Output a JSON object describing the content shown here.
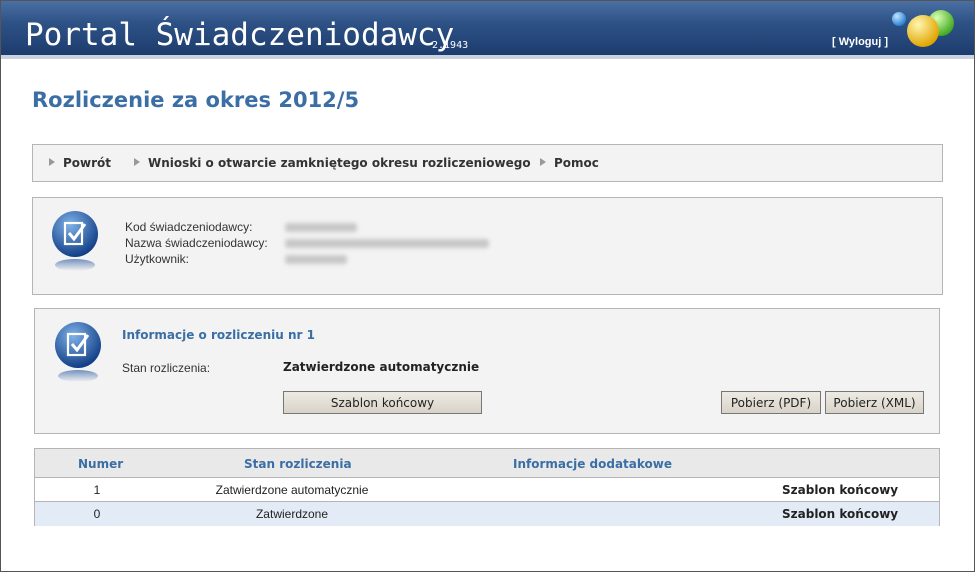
{
  "header": {
    "app_title": "Portal Świadczeniodawcy",
    "version": "2.1943",
    "logout_label": "[ Wyloguj ]",
    "colors": {
      "bar": "#2e5286",
      "ball_blue": "#3a9be0",
      "ball_yellow": "#f0c419",
      "ball_green": "#66cc33"
    }
  },
  "page": {
    "title": "Rozliczenie za okres 2012/5"
  },
  "nav": {
    "items": [
      {
        "label": "Powrót"
      },
      {
        "label": "Wnioski o otwarcie zamkniętego okresu rozliczeniowego"
      },
      {
        "label": "Pomoc"
      }
    ]
  },
  "user_panel": {
    "icon": "document-check-icon",
    "fields": [
      {
        "label": "Kod świadczeniodawcy:"
      },
      {
        "label": "Nazwa świadczeniodawcy:"
      },
      {
        "label": "Użytkownik:"
      }
    ]
  },
  "info_panel": {
    "icon": "document-check-icon",
    "title": "Informacje o rozliczeniu nr 1",
    "state_label": "Stan rozliczenia:",
    "state_value": "Zatwierdzone automatycznie",
    "template_button": "Szablon końcowy",
    "pdf_button": "Pobierz (PDF)",
    "xml_button": "Pobierz (XML)"
  },
  "table": {
    "headers": {
      "numer": "Numer",
      "stan": "Stan rozliczenia",
      "info": "Informacje dodatakowe"
    },
    "rows": [
      {
        "numer": "1",
        "stan": "Zatwierdzone automatycznie",
        "info": "",
        "action": "Szablon końcowy"
      },
      {
        "numer": "0",
        "stan": "Zatwierdzone",
        "info": "",
        "action": "Szablon końcowy"
      }
    ]
  }
}
